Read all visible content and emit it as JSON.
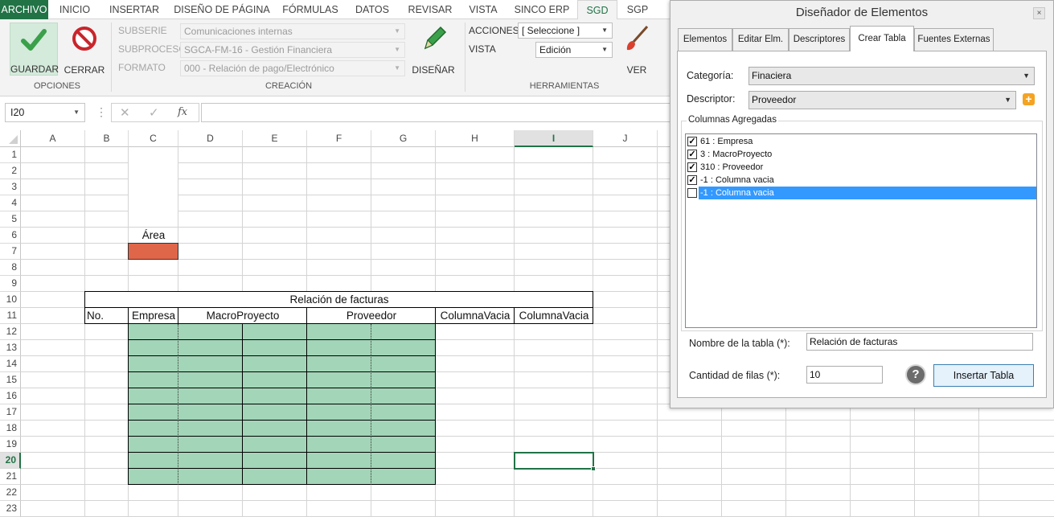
{
  "ribbon_tabs": [
    "ARCHIVO",
    "INICIO",
    "INSERTAR",
    "DISEÑO DE PÁGINA",
    "FÓRMULAS",
    "DATOS",
    "REVISAR",
    "VISTA",
    "SINCO ERP",
    "SGD",
    "SGP"
  ],
  "active_tab": "SGD",
  "colors": {
    "excel_green": "#217346",
    "area_orange": "#e0664a",
    "table_green": "#a3d5b8",
    "selection_blue": "#3399ff"
  },
  "ribbon": {
    "opciones": {
      "guardar": "GUARDAR",
      "cerrar": "CERRAR",
      "group": "OPCIONES"
    },
    "creacion": {
      "subserie_label": "SUBSERIE",
      "subserie_value": "Comunicaciones internas",
      "subproceso_label": "SUBPROCESO",
      "subproceso_value": "SGCA-FM-16 - Gestión Financiera",
      "formato_label": "FORMATO",
      "formato_value": "000 - Relación de pago/Electrónico",
      "disenar": "DISEÑAR",
      "group": "CREACIÓN"
    },
    "herramientas": {
      "acciones_label": "ACCIONES",
      "acciones_value": "[ Seleccione ]",
      "vista_label": "VISTA",
      "vista_value": "Edición",
      "ver": "VER",
      "group": "HERRAMIENTAS"
    }
  },
  "formula_bar": {
    "name_box": "I20",
    "fx": "fx",
    "formula": ""
  },
  "sheet": {
    "columns": [
      "A",
      "B",
      "C",
      "D",
      "E",
      "F",
      "G",
      "H",
      "I",
      "J"
    ],
    "rows": [
      "1",
      "2",
      "3",
      "4",
      "5",
      "6",
      "7",
      "8",
      "9",
      "10",
      "11",
      "12",
      "13",
      "14",
      "15",
      "16",
      "17",
      "18",
      "19",
      "20",
      "21",
      "22",
      "23"
    ],
    "selected_column": "I",
    "selected_row": "20",
    "area_label": "Área",
    "table_title": "Relación de facturas",
    "table_headers": [
      "No.",
      "Empresa",
      "MacroProyecto",
      "Proveedor",
      "ColumnaVacia",
      "ColumnaVacia"
    ]
  },
  "panel": {
    "title": "Diseñador de Elementos",
    "close": "×",
    "tabs": [
      "Elementos",
      "Editar Elm.",
      "Descriptores",
      "Crear Tabla",
      "Fuentes Externas"
    ],
    "active_tab": "Crear Tabla",
    "categoria_label": "Categoría:",
    "categoria_value": "Finaciera",
    "descriptor_label": "Descriptor:",
    "descriptor_value": "Proveedor",
    "columns_group": "Columnas Agregadas",
    "columns": [
      {
        "label": "61 : Empresa",
        "checked": true
      },
      {
        "label": "3 : MacroProyecto",
        "checked": true
      },
      {
        "label": "310 : Proveedor",
        "checked": true
      },
      {
        "label": "-1 : Columna vacia",
        "checked": true
      },
      {
        "label": "-1 : Columna vacia",
        "checked": false,
        "selected": true
      }
    ],
    "table_name_label": "Nombre de la tabla (*):",
    "table_name_value": "Relación de facturas",
    "rows_label": "Cantidad de filas (*):",
    "rows_value": "10",
    "help": "?",
    "insert_button": "Insertar Tabla"
  }
}
